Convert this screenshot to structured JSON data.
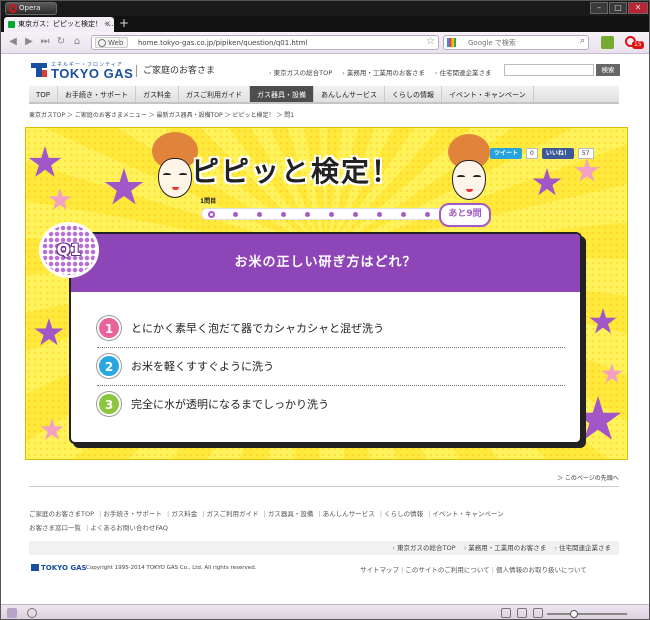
{
  "browser": {
    "app_name": "Opera",
    "tab_title": "東京ガス：ピピッと検定！ -...",
    "new_tab_symbol": "+",
    "address_badge": "Web",
    "url": "home.tokyo-gas.co.jp/pipiken/question/q01.html",
    "search_placeholder": "Google で検索",
    "notification_count": "15"
  },
  "header": {
    "logo_subtext": "エネルギー・フロンティア",
    "logo_text": "TOKYO GAS",
    "site_name": "ご家庭のお客さま",
    "top_links": [
      "東京ガスの総合TOP",
      "業務用・工業用のお客さま",
      "住宅関連企業さま"
    ],
    "search_button": "検索"
  },
  "nav": {
    "items": [
      {
        "label": "TOP"
      },
      {
        "label": "お手続き・サポート"
      },
      {
        "label": "ガス料金"
      },
      {
        "label": "ガスご利用ガイド"
      },
      {
        "label": "ガス器具・設備"
      },
      {
        "label": "あんしんサービス"
      },
      {
        "label": "くらしの情報"
      },
      {
        "label": "イベント・キャンペーン"
      }
    ],
    "active_index": 4
  },
  "breadcrumb": "東京ガスTOP ＞ ご家庭のお客さまメニュー ＞ 最新ガス器具・設備TOP ＞ ピピッと検定！ ＞ 問1",
  "quiz": {
    "title": "ピピッと検定！",
    "question_counter": "1問目",
    "remaining": "あと9問",
    "progress": {
      "current": 1,
      "total": 10
    },
    "badge": "Q1",
    "social": {
      "tweet": "ツイート",
      "tweet_count": "0",
      "like": "いいね！",
      "like_count": "57"
    },
    "question": "お米の正しい研ぎ方はどれ？",
    "answers": [
      {
        "num": "1",
        "text": "とにかく素早く泡だて器でカシャカシャと混ぜ洗う",
        "color": "#e8629c"
      },
      {
        "num": "2",
        "text": "お米を軽くすすぐように洗う",
        "color": "#2aa7e0"
      },
      {
        "num": "3",
        "text": "完全に水が透明になるまでしっかり洗う",
        "color": "#8cc63f"
      }
    ]
  },
  "footer": {
    "back_to_top": "＞ このページの先頭へ",
    "links": [
      "ご家庭のお客さまTOP",
      "お手続き・サポート",
      "ガス料金",
      "ガスご利用ガイド",
      "ガス器具・設備",
      "あんしんサービス",
      "くらしの情報",
      "イベント・キャンペーン",
      "お客さま窓口一覧",
      "よくあるお問い合わせFAQ"
    ],
    "bar_links": [
      "東京ガスの総合TOP",
      "業務用・工業用のお客さま",
      "住宅関連企業さま"
    ],
    "logo_text": "TOKYO GAS",
    "copyright": "Copyright 1995-2014 TOKYO GAS Co., Ltd. All rights reserved.",
    "bottom_links": [
      "サイトマップ",
      "このサイトのご利用について",
      "個人情報のお取り扱いについて"
    ]
  },
  "colors": {
    "accent_purple": "#8e45b8",
    "hero_yellow": "#ffe93d",
    "brand_blue": "#1a4fa0"
  }
}
